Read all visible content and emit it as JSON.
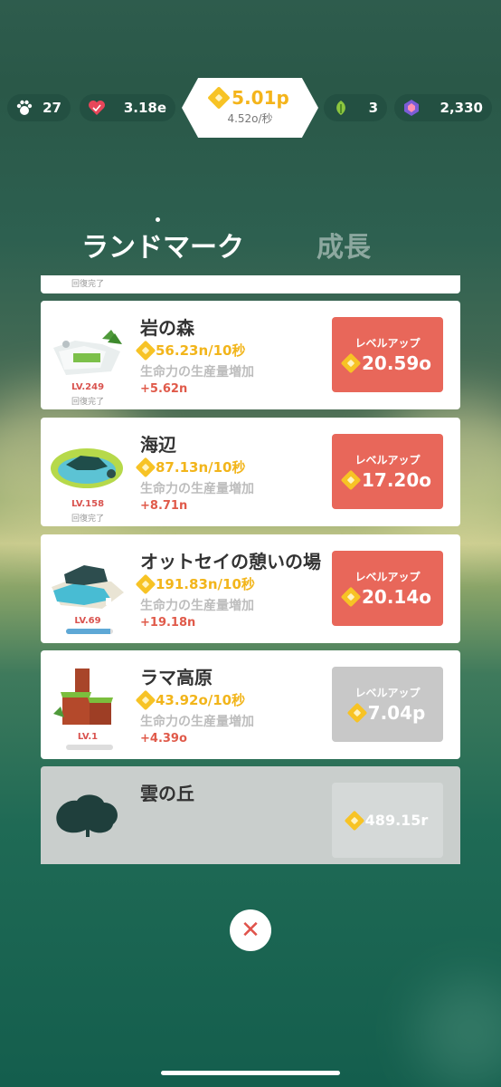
{
  "topbar": {
    "paw": {
      "icon": "paw-icon",
      "value": "27"
    },
    "hearts": {
      "icon": "heart-icon",
      "value": "3.18e"
    },
    "currency": {
      "main": "5.01p",
      "rate": "4.52o/秒"
    },
    "leaves": {
      "icon": "leaf-icon",
      "value": "3"
    },
    "gems": {
      "icon": "gem-icon",
      "value": "2,330"
    }
  },
  "tabs": [
    {
      "label": "ランドマーク",
      "active": true
    },
    {
      "label": "成長",
      "active": false
    }
  ],
  "landmarks": [
    {
      "name": "",
      "level": "",
      "status": "回復完了",
      "partial": true
    },
    {
      "name": "岩の森",
      "level": "LV.249",
      "status": "回復完了",
      "rate": "56.23n/10秒",
      "effect": "生命力の生産量増加",
      "increase": "+5.62n",
      "button_label": "レベルアップ",
      "cost": "20.59o",
      "affordable": true
    },
    {
      "name": "海辺",
      "level": "LV.158",
      "status": "回復完了",
      "rate": "87.13n/10秒",
      "effect": "生命力の生産量増加",
      "increase": "+8.71n",
      "button_label": "レベルアップ",
      "cost": "17.20o",
      "affordable": true
    },
    {
      "name": "オットセイの憩いの場",
      "level": "LV.69",
      "progress": 0.95,
      "rate": "191.83n/10秒",
      "effect": "生命力の生産量増加",
      "increase": "+19.18n",
      "button_label": "レベルアップ",
      "cost": "20.14o",
      "affordable": true
    },
    {
      "name": "ラマ高原",
      "level": "LV.1",
      "progress": 0.0,
      "rate": "43.92o/10秒",
      "effect": "生命力の生産量増加",
      "increase": "+4.39o",
      "button_label": "レベルアップ",
      "cost": "7.04p",
      "affordable": false
    },
    {
      "name": "雲の丘",
      "locked": true,
      "cost": "489.15r"
    }
  ],
  "colors": {
    "accent": "#e8675a",
    "coin": "#f2b51b",
    "level": "#d9534f"
  }
}
